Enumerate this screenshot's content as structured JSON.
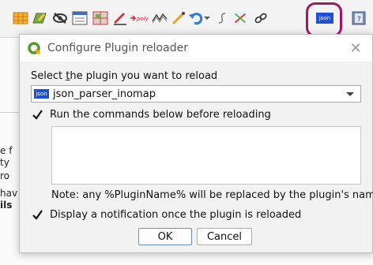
{
  "background": {
    "left_fragments": [
      "e f",
      "ty",
      "ro",
      "hav",
      "ils"
    ],
    "right_fragments": [
      "2"
    ]
  },
  "toolbar": {
    "icons": [
      "attribute-table-icon",
      "pencil-layer-icon",
      "hide-eye-icon",
      "field-calculator-icon",
      "grid-icon",
      "digitize-icon",
      "polygon-tool-icon",
      "trace-icon",
      "node-tool-icon",
      "undo-icon",
      "dropdown-icon",
      "curve-icon",
      "vertex-tool-icon",
      "link-icon",
      "json-plugin-icon",
      "help-icon"
    ],
    "json_icon_text": "json",
    "polygon_icon_text": "poly"
  },
  "dialog": {
    "title": "Configure Plugin reloader",
    "select_label_pre": "Select ",
    "select_label_mnemonic": "t",
    "select_label_post": "he plugin you want to reload",
    "selected_plugin": "json_parser_inomap",
    "plugin_icon_text": "json",
    "run_commands_label": "Run the commands below before reloading",
    "run_commands_checked": true,
    "commands_text": "",
    "note": "Note: any %PluginName% will be replaced by the plugin's name.",
    "notify_label": "Display a notification once the plugin is reloaded",
    "notify_checked": true,
    "ok_label": "OK",
    "cancel_label": "Cancel"
  },
  "colors": {
    "highlight": "#a3175e",
    "json_badge": "#1f4fd6",
    "qgis_green": "#589632"
  }
}
